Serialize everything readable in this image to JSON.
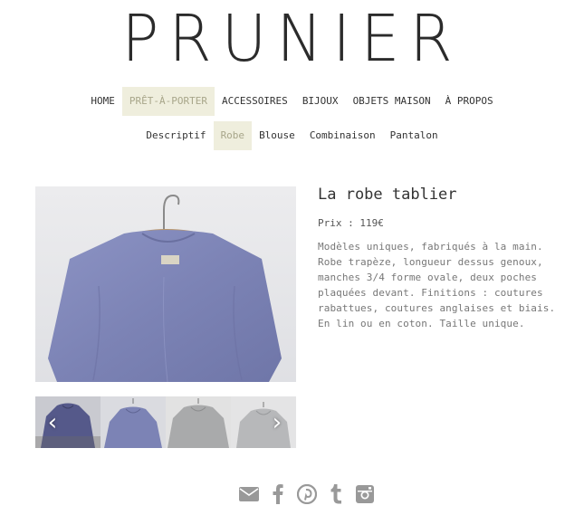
{
  "brand": {
    "logo": "PRUNIER"
  },
  "nav": {
    "main": [
      {
        "label": "HOME",
        "active": false
      },
      {
        "label": "PRÊT-À-PORTER",
        "active": true
      },
      {
        "label": "ACCESSOIRES",
        "active": false
      },
      {
        "label": "BIJOUX",
        "active": false
      },
      {
        "label": "OBJETS MAISON",
        "active": false
      },
      {
        "label": "À PROPOS",
        "active": false
      }
    ],
    "sub": [
      {
        "label": "Descriptif",
        "active": false
      },
      {
        "label": "Robe",
        "active": true
      },
      {
        "label": "Blouse",
        "active": false
      },
      {
        "label": "Combinaison",
        "active": false
      },
      {
        "label": "Pantalon",
        "active": false
      }
    ]
  },
  "product": {
    "title": "La robe tablier",
    "price": "Prix : 119€",
    "description": "Modèles uniques, fabriqués à la main. Robe trapèze, longueur dessus genoux, manches 3/4 forme ovale, deux poches plaquées devant. Finitions : coutures rabattues, coutures anglaises et biais. En lin ou en coton. Taille unique."
  },
  "gallery": {
    "thumbnails": [
      "blue dress on hanger",
      "blue linen dress",
      "grey dress on hanger",
      "light grey dress"
    ],
    "prev_icon": "chevron-left-icon",
    "next_icon": "chevron-right-icon"
  },
  "social": [
    "envelope-icon",
    "facebook-icon",
    "pinterest-icon",
    "tumblr-icon",
    "instagram-icon"
  ],
  "colors": {
    "active_bg": "#efeedd",
    "active_text": "#a8a68a",
    "icon": "#999999",
    "dress": "#7f86b7"
  }
}
